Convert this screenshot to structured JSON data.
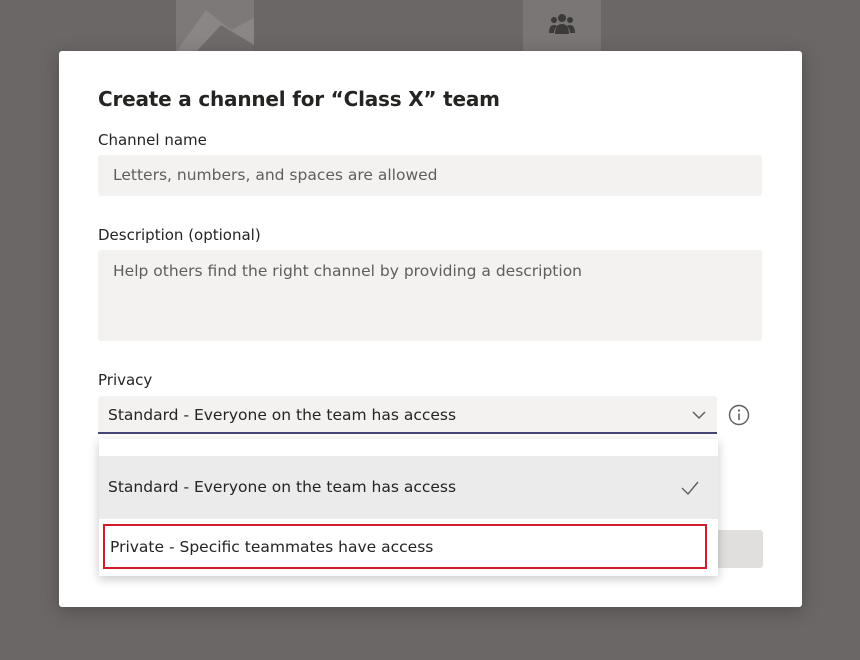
{
  "dialog": {
    "title": "Create a channel for “Class X” team",
    "channel_name": {
      "label": "Channel name",
      "placeholder": "Letters, numbers, and spaces are allowed"
    },
    "description": {
      "label": "Description (optional)",
      "placeholder": "Help others find the right channel by providing a description"
    },
    "privacy": {
      "label": "Privacy",
      "selected": "Standard - Everyone on the team has access",
      "options": [
        {
          "label": "Standard - Everyone on the team has access",
          "checked": true
        },
        {
          "label": "Private - Specific teammates have access",
          "highlighted": true
        }
      ]
    }
  },
  "icons": {
    "chevron": "chevron-down-icon",
    "info": "info-icon",
    "check": "check-icon",
    "teams": "people-icon"
  },
  "colors": {
    "accent_underline": "#464775",
    "highlight_border": "#d21b2a",
    "field_background": "#f3f2f1",
    "overlay": "#6b6766"
  }
}
